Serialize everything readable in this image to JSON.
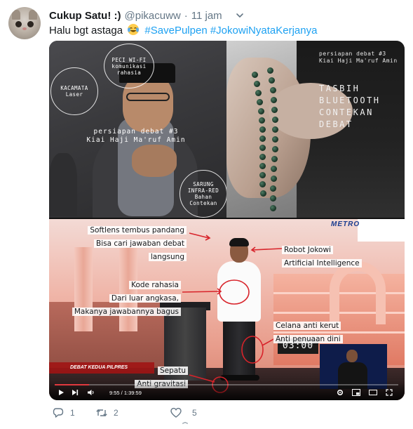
{
  "tweet": {
    "display_name": "Cukup Satu! :)",
    "handle": "@pikacuww",
    "separator": "·",
    "time": "11 jam",
    "text_before": "Halu bgt astaga",
    "emoji": "face-with-tears-of-joy",
    "hashtags": [
      "#SavePulpen",
      "#JokowiNyataKerjanya"
    ]
  },
  "media": {
    "panel1": {
      "circle_peci": "PECI WI-FI\nkomunikasi\nrahasia",
      "circle_kacamata": "KACAMATA\nLaser",
      "caption": "persiapan debat #3\nKiai Haji Ma'ruf Amin",
      "circle_sarung": "SARUNG\nINFRA-RED\nBahan\nContekan"
    },
    "panel2": {
      "subtitle": "persiapan debat #3\nKiai Haji Ma'ruf Amin",
      "title": "TASBIH\nBLUETOOTH\nCONTEKAN\nDEBAT"
    },
    "panel3": {
      "anno_softlens": [
        "Softlens tembus pandang",
        "Bisa cari jawaban debat",
        "langsung"
      ],
      "anno_robot": [
        "Robot Jokowi",
        "Artificial Intelligence"
      ],
      "anno_kode": [
        "Kode rahasia",
        "Dari luar angkasa,",
        "Makanya jawabannya bagus"
      ],
      "anno_celana": [
        "Celana anti kerut",
        "Anti penuaan dini"
      ],
      "anno_sepatu": [
        "Sepatu",
        "Anti gravitasi"
      ],
      "channel_logo": "METRO",
      "ticker": "DEBAT KEDUA PILPRES",
      "clock": "03:00",
      "player_time": "9:55 / 1:39:59",
      "progress_fraction": 0.1
    }
  },
  "actions": {
    "reply_count": "1",
    "retweet_count": "2",
    "like_count": "5"
  },
  "colors": {
    "hashtag": "#1da1f2",
    "muted": "#657786",
    "annotation_red": "#d8232a"
  }
}
